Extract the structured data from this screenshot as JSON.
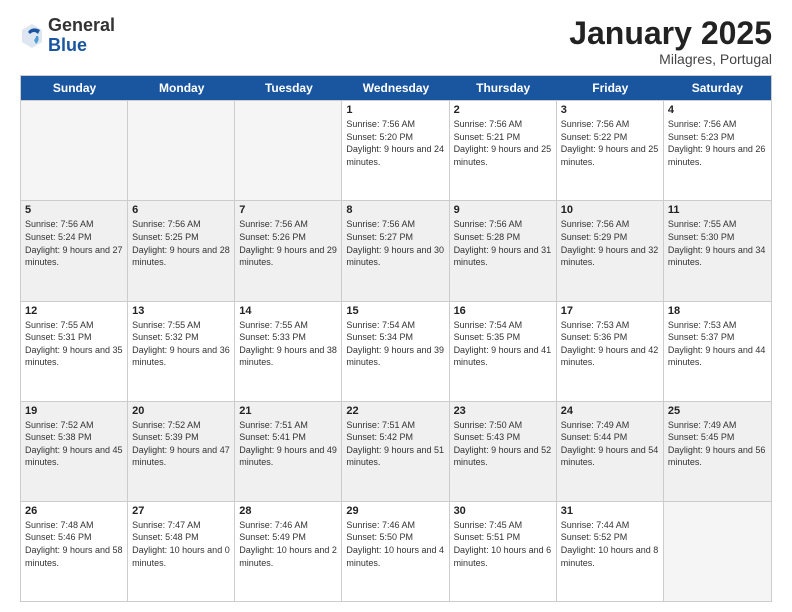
{
  "logo": {
    "general": "General",
    "blue": "Blue"
  },
  "header": {
    "month": "January 2025",
    "location": "Milagres, Portugal"
  },
  "weekdays": [
    "Sunday",
    "Monday",
    "Tuesday",
    "Wednesday",
    "Thursday",
    "Friday",
    "Saturday"
  ],
  "rows": [
    [
      {
        "day": "",
        "empty": true
      },
      {
        "day": "",
        "empty": true
      },
      {
        "day": "",
        "empty": true
      },
      {
        "day": "1",
        "sunrise": "Sunrise: 7:56 AM",
        "sunset": "Sunset: 5:20 PM",
        "daylight": "Daylight: 9 hours and 24 minutes."
      },
      {
        "day": "2",
        "sunrise": "Sunrise: 7:56 AM",
        "sunset": "Sunset: 5:21 PM",
        "daylight": "Daylight: 9 hours and 25 minutes."
      },
      {
        "day": "3",
        "sunrise": "Sunrise: 7:56 AM",
        "sunset": "Sunset: 5:22 PM",
        "daylight": "Daylight: 9 hours and 25 minutes."
      },
      {
        "day": "4",
        "sunrise": "Sunrise: 7:56 AM",
        "sunset": "Sunset: 5:23 PM",
        "daylight": "Daylight: 9 hours and 26 minutes."
      }
    ],
    [
      {
        "day": "5",
        "sunrise": "Sunrise: 7:56 AM",
        "sunset": "Sunset: 5:24 PM",
        "daylight": "Daylight: 9 hours and 27 minutes."
      },
      {
        "day": "6",
        "sunrise": "Sunrise: 7:56 AM",
        "sunset": "Sunset: 5:25 PM",
        "daylight": "Daylight: 9 hours and 28 minutes."
      },
      {
        "day": "7",
        "sunrise": "Sunrise: 7:56 AM",
        "sunset": "Sunset: 5:26 PM",
        "daylight": "Daylight: 9 hours and 29 minutes."
      },
      {
        "day": "8",
        "sunrise": "Sunrise: 7:56 AM",
        "sunset": "Sunset: 5:27 PM",
        "daylight": "Daylight: 9 hours and 30 minutes."
      },
      {
        "day": "9",
        "sunrise": "Sunrise: 7:56 AM",
        "sunset": "Sunset: 5:28 PM",
        "daylight": "Daylight: 9 hours and 31 minutes."
      },
      {
        "day": "10",
        "sunrise": "Sunrise: 7:56 AM",
        "sunset": "Sunset: 5:29 PM",
        "daylight": "Daylight: 9 hours and 32 minutes."
      },
      {
        "day": "11",
        "sunrise": "Sunrise: 7:55 AM",
        "sunset": "Sunset: 5:30 PM",
        "daylight": "Daylight: 9 hours and 34 minutes."
      }
    ],
    [
      {
        "day": "12",
        "sunrise": "Sunrise: 7:55 AM",
        "sunset": "Sunset: 5:31 PM",
        "daylight": "Daylight: 9 hours and 35 minutes."
      },
      {
        "day": "13",
        "sunrise": "Sunrise: 7:55 AM",
        "sunset": "Sunset: 5:32 PM",
        "daylight": "Daylight: 9 hours and 36 minutes."
      },
      {
        "day": "14",
        "sunrise": "Sunrise: 7:55 AM",
        "sunset": "Sunset: 5:33 PM",
        "daylight": "Daylight: 9 hours and 38 minutes."
      },
      {
        "day": "15",
        "sunrise": "Sunrise: 7:54 AM",
        "sunset": "Sunset: 5:34 PM",
        "daylight": "Daylight: 9 hours and 39 minutes."
      },
      {
        "day": "16",
        "sunrise": "Sunrise: 7:54 AM",
        "sunset": "Sunset: 5:35 PM",
        "daylight": "Daylight: 9 hours and 41 minutes."
      },
      {
        "day": "17",
        "sunrise": "Sunrise: 7:53 AM",
        "sunset": "Sunset: 5:36 PM",
        "daylight": "Daylight: 9 hours and 42 minutes."
      },
      {
        "day": "18",
        "sunrise": "Sunrise: 7:53 AM",
        "sunset": "Sunset: 5:37 PM",
        "daylight": "Daylight: 9 hours and 44 minutes."
      }
    ],
    [
      {
        "day": "19",
        "sunrise": "Sunrise: 7:52 AM",
        "sunset": "Sunset: 5:38 PM",
        "daylight": "Daylight: 9 hours and 45 minutes."
      },
      {
        "day": "20",
        "sunrise": "Sunrise: 7:52 AM",
        "sunset": "Sunset: 5:39 PM",
        "daylight": "Daylight: 9 hours and 47 minutes."
      },
      {
        "day": "21",
        "sunrise": "Sunrise: 7:51 AM",
        "sunset": "Sunset: 5:41 PM",
        "daylight": "Daylight: 9 hours and 49 minutes."
      },
      {
        "day": "22",
        "sunrise": "Sunrise: 7:51 AM",
        "sunset": "Sunset: 5:42 PM",
        "daylight": "Daylight: 9 hours and 51 minutes."
      },
      {
        "day": "23",
        "sunrise": "Sunrise: 7:50 AM",
        "sunset": "Sunset: 5:43 PM",
        "daylight": "Daylight: 9 hours and 52 minutes."
      },
      {
        "day": "24",
        "sunrise": "Sunrise: 7:49 AM",
        "sunset": "Sunset: 5:44 PM",
        "daylight": "Daylight: 9 hours and 54 minutes."
      },
      {
        "day": "25",
        "sunrise": "Sunrise: 7:49 AM",
        "sunset": "Sunset: 5:45 PM",
        "daylight": "Daylight: 9 hours and 56 minutes."
      }
    ],
    [
      {
        "day": "26",
        "sunrise": "Sunrise: 7:48 AM",
        "sunset": "Sunset: 5:46 PM",
        "daylight": "Daylight: 9 hours and 58 minutes."
      },
      {
        "day": "27",
        "sunrise": "Sunrise: 7:47 AM",
        "sunset": "Sunset: 5:48 PM",
        "daylight": "Daylight: 10 hours and 0 minutes."
      },
      {
        "day": "28",
        "sunrise": "Sunrise: 7:46 AM",
        "sunset": "Sunset: 5:49 PM",
        "daylight": "Daylight: 10 hours and 2 minutes."
      },
      {
        "day": "29",
        "sunrise": "Sunrise: 7:46 AM",
        "sunset": "Sunset: 5:50 PM",
        "daylight": "Daylight: 10 hours and 4 minutes."
      },
      {
        "day": "30",
        "sunrise": "Sunrise: 7:45 AM",
        "sunset": "Sunset: 5:51 PM",
        "daylight": "Daylight: 10 hours and 6 minutes."
      },
      {
        "day": "31",
        "sunrise": "Sunrise: 7:44 AM",
        "sunset": "Sunset: 5:52 PM",
        "daylight": "Daylight: 10 hours and 8 minutes."
      },
      {
        "day": "",
        "empty": true
      }
    ]
  ]
}
